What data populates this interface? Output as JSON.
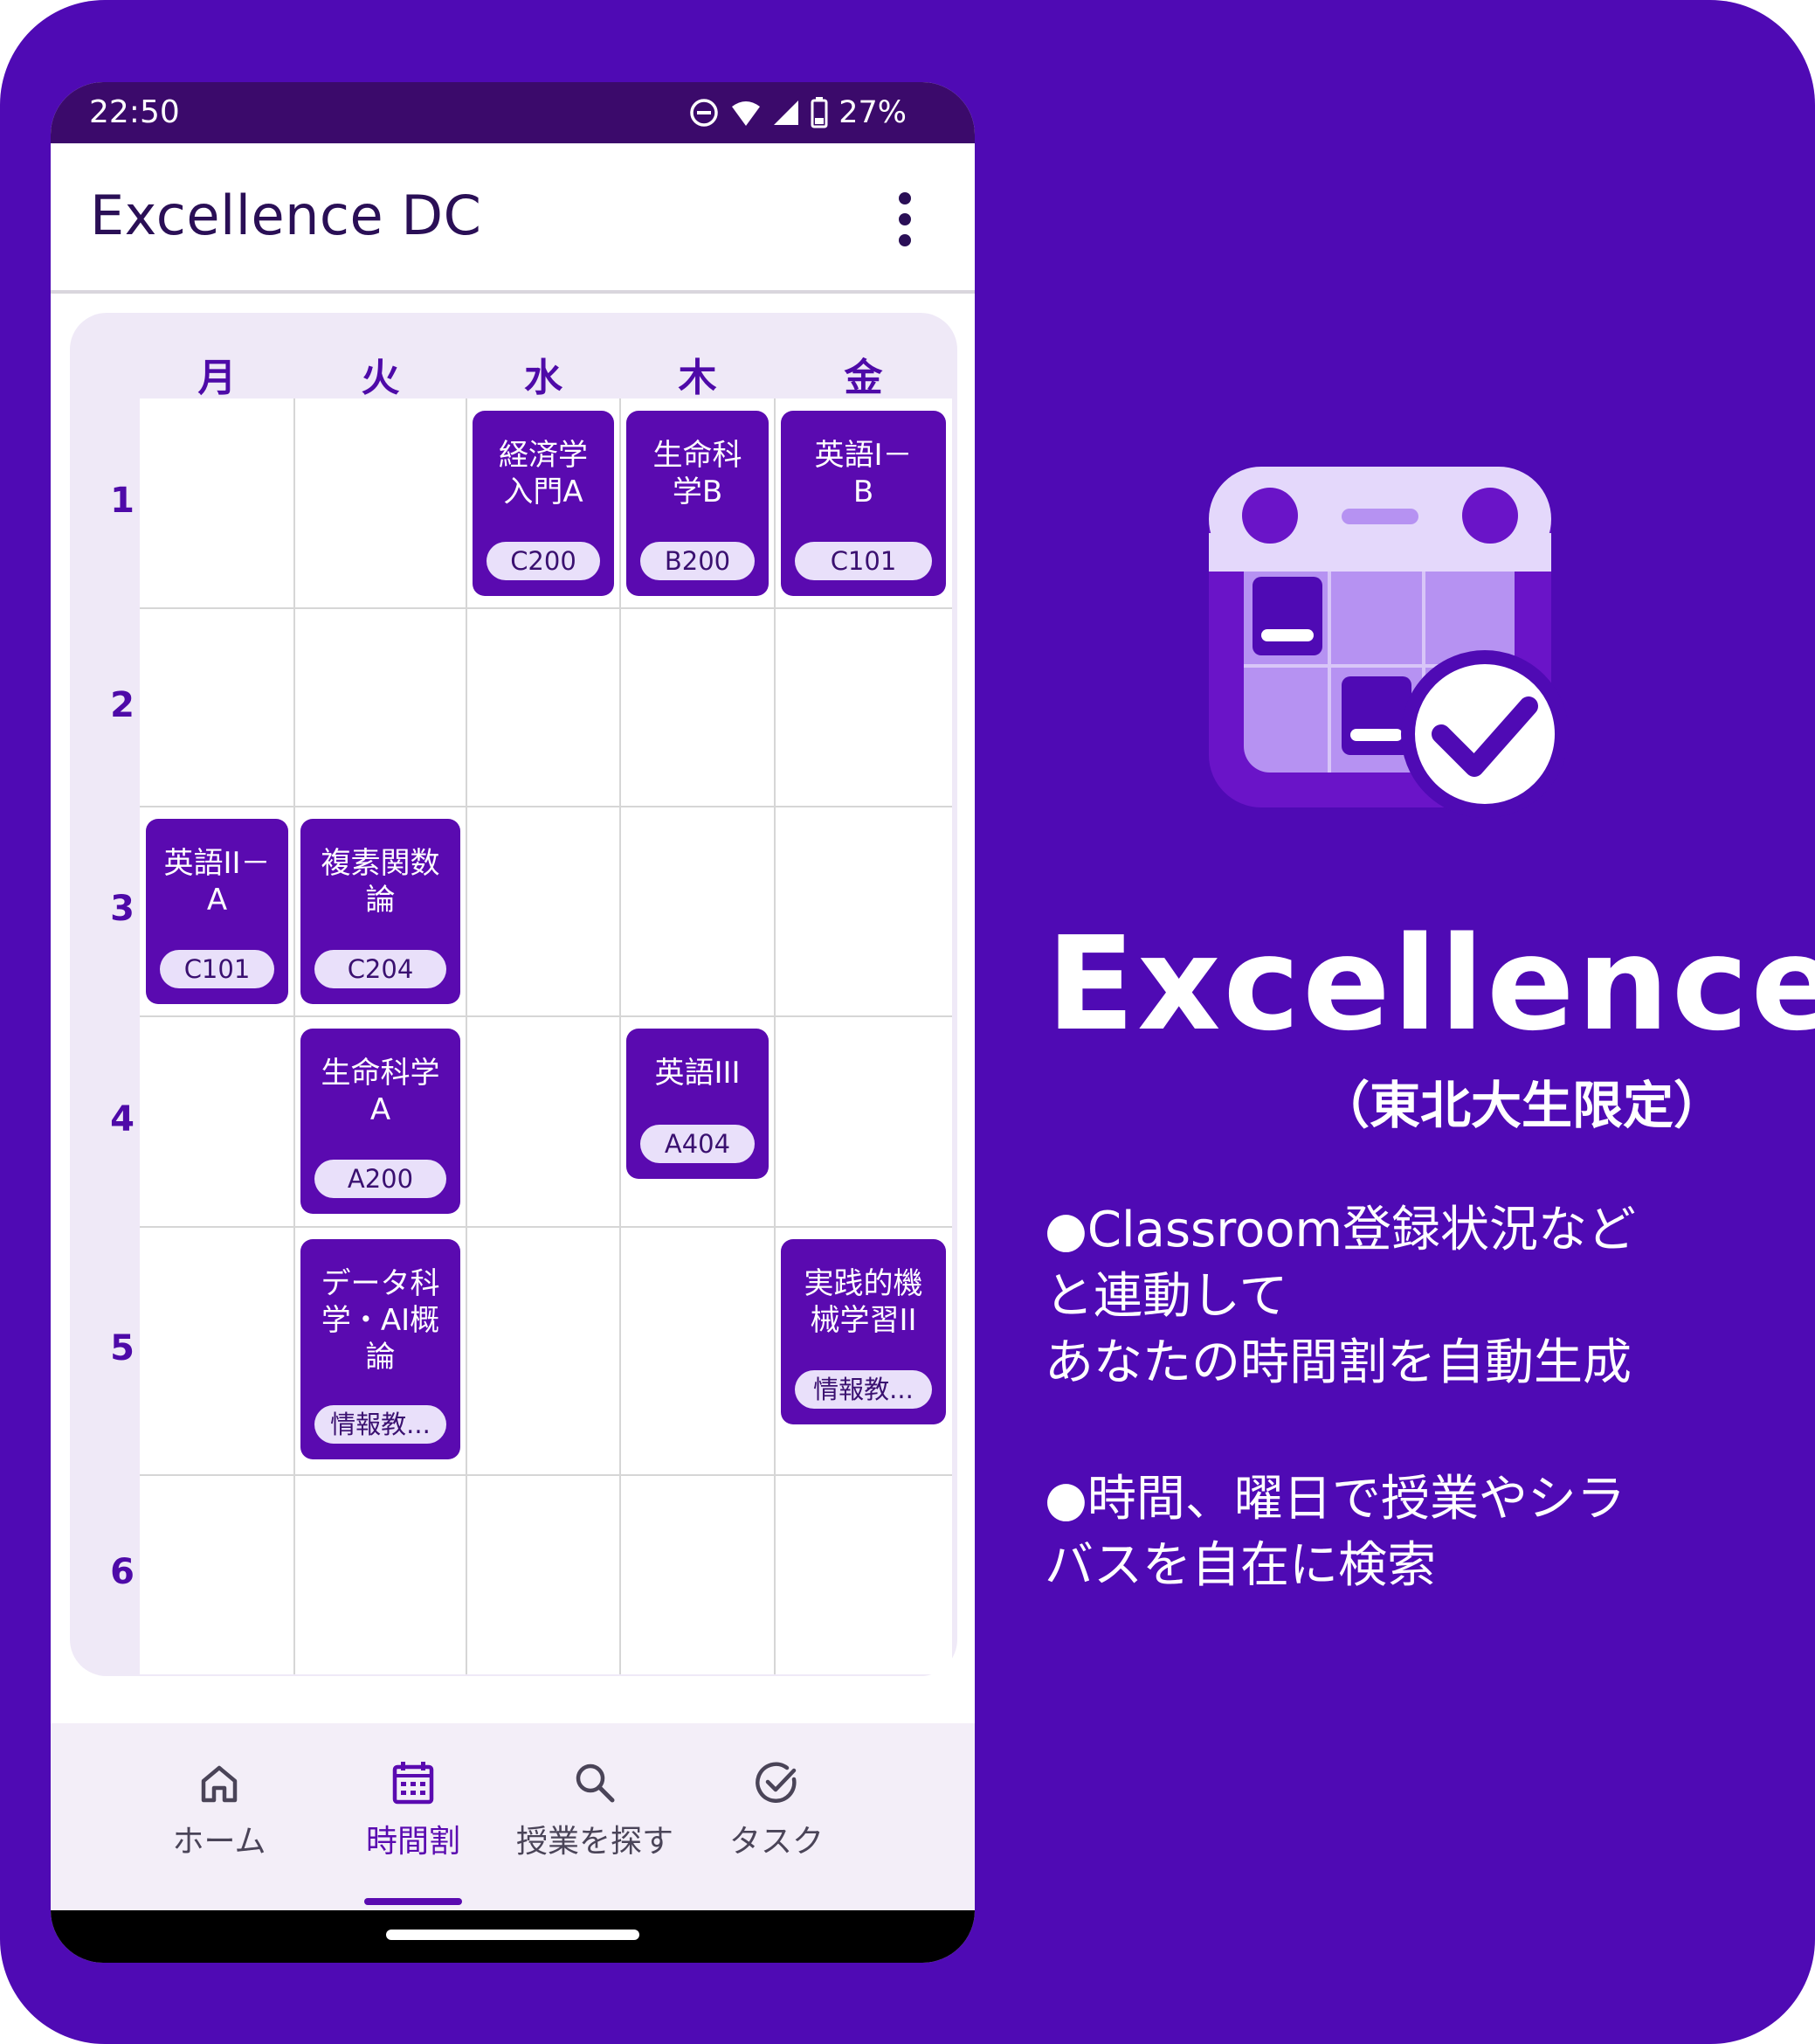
{
  "status": {
    "time": "22:50",
    "battery": "27%"
  },
  "app": {
    "title": "Excellence DC"
  },
  "timetable": {
    "days": [
      "月",
      "火",
      "水",
      "木",
      "金"
    ],
    "periods": [
      "1",
      "2",
      "3",
      "4",
      "5",
      "6"
    ],
    "courses": [
      {
        "day": 2,
        "period": 0,
        "name_lines": [
          "経済学",
          "入門A"
        ],
        "room": "C200"
      },
      {
        "day": 3,
        "period": 0,
        "name_lines": [
          "生命科",
          "学B"
        ],
        "room": "B200"
      },
      {
        "day": 4,
        "period": 0,
        "name_lines": [
          "英語I－",
          "B"
        ],
        "room": "C101"
      },
      {
        "day": 0,
        "period": 2,
        "name_lines": [
          "英語II－",
          "A"
        ],
        "room": "C101"
      },
      {
        "day": 1,
        "period": 2,
        "name_lines": [
          "複素関数",
          "論"
        ],
        "room": "C204"
      },
      {
        "day": 1,
        "period": 3,
        "name_lines": [
          "生命科学",
          "A"
        ],
        "room": "A200"
      },
      {
        "day": 3,
        "period": 3,
        "name_lines": [
          "英語III"
        ],
        "room": "A404"
      },
      {
        "day": 1,
        "period": 4,
        "name_lines": [
          "データ科",
          "学・AI概",
          "論"
        ],
        "room": "情報教..."
      },
      {
        "day": 4,
        "period": 4,
        "name_lines": [
          "実践的機",
          "械学習II"
        ],
        "room": "情報教..."
      }
    ]
  },
  "fab": {
    "label": "+"
  },
  "nav": {
    "items": [
      {
        "label": "ホーム",
        "icon": "home-icon"
      },
      {
        "label": "時間割",
        "icon": "calendar-icon",
        "active": true
      },
      {
        "label": "授業を探す",
        "icon": "search-icon"
      },
      {
        "label": "タスク",
        "icon": "check-circle-icon"
      }
    ]
  },
  "promo": {
    "title": "Excellence",
    "subtitle": "（東北大生限定）",
    "feature1_lines": [
      "●Classroom登録状況など",
      "と連動して",
      "あなたの時間割を自動生成"
    ],
    "feature2_lines": [
      "●時間、曜日で授業やシラ",
      "バスを自在に検索"
    ]
  },
  "colors": {
    "background": "#4f0ab4",
    "accent": "#5a0ab0",
    "status_bar": "#3b0a6b"
  }
}
